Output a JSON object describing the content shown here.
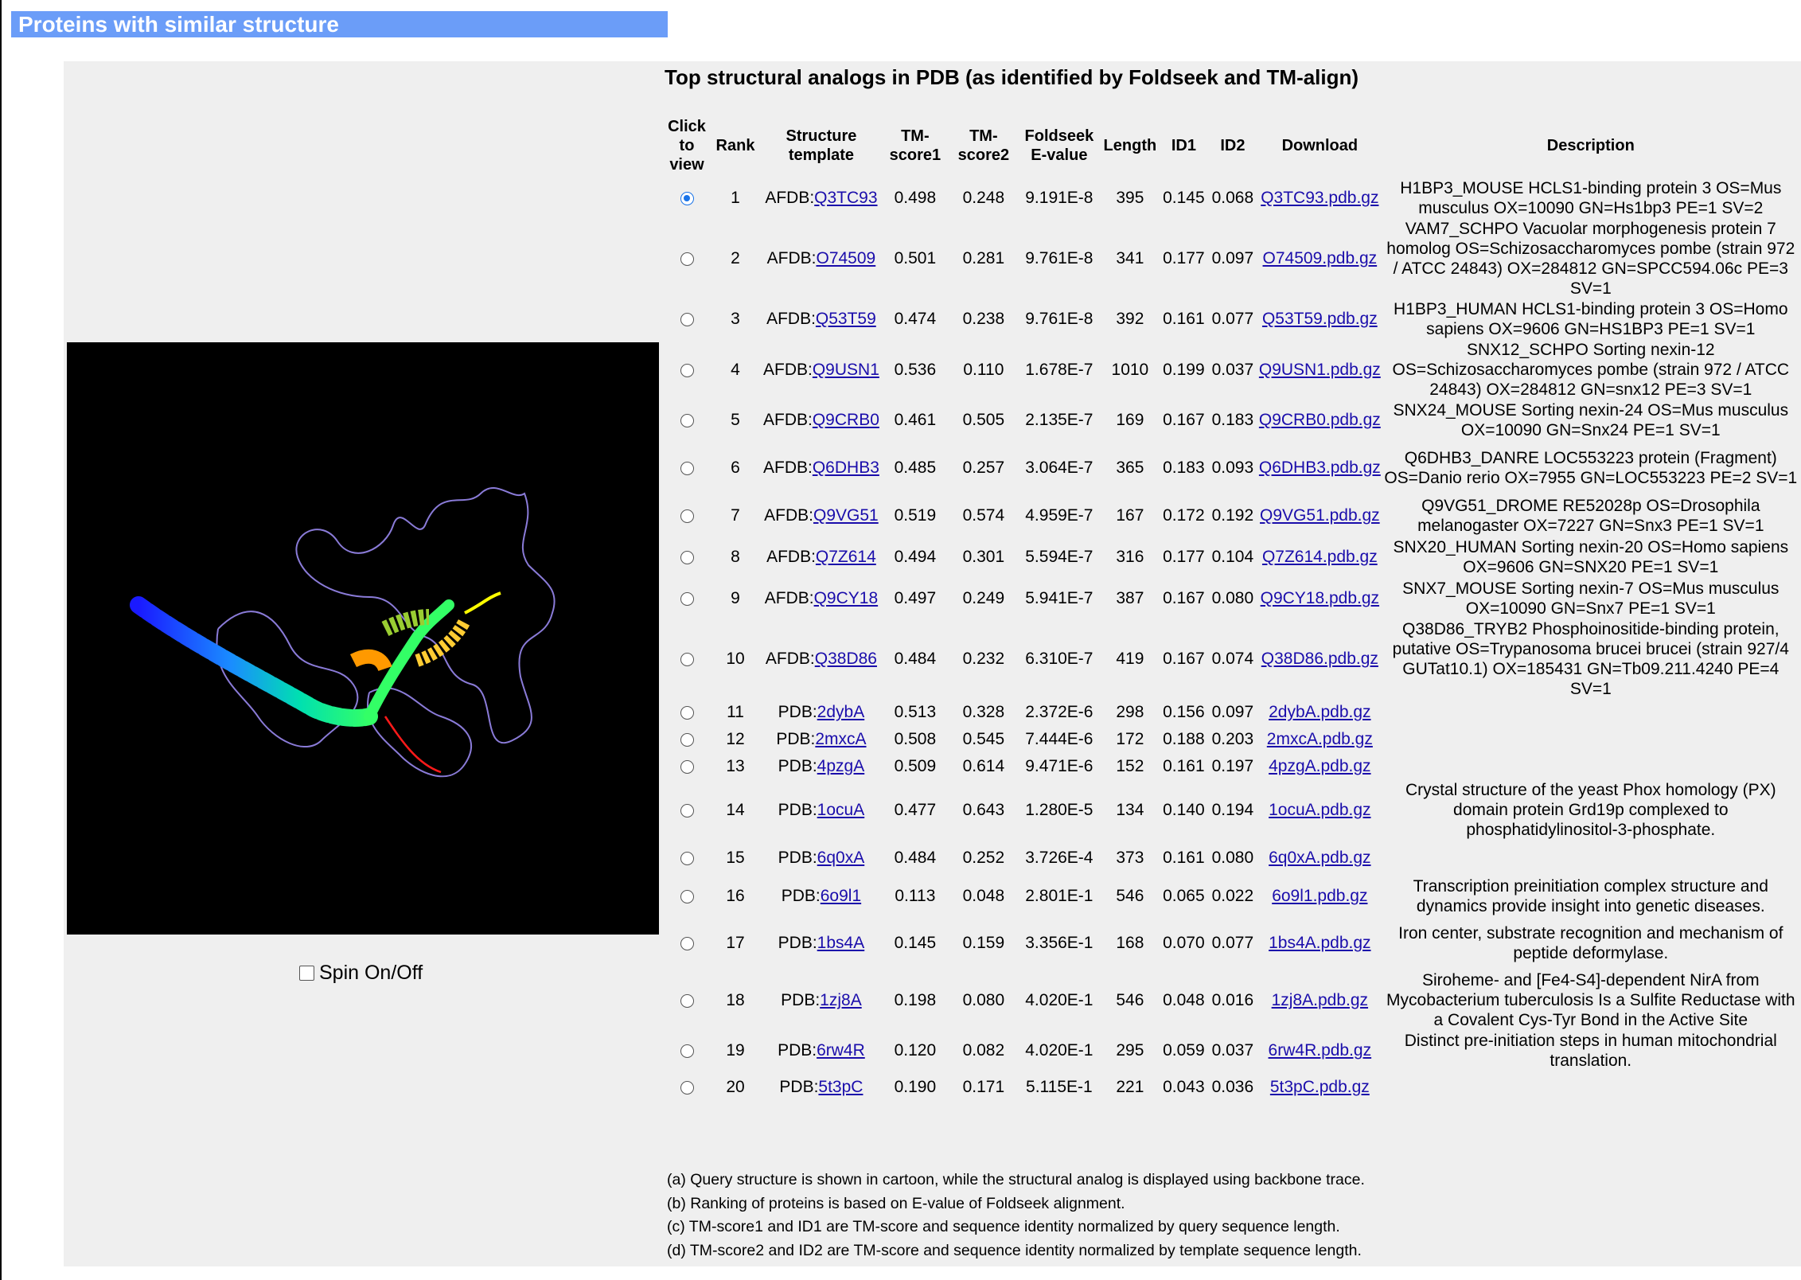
{
  "header": {
    "title": "Proteins with similar structure"
  },
  "viewer": {
    "spin_label": "Spin On/Off",
    "spin_checked": false
  },
  "table": {
    "title": "Top structural analogs in PDB (as identified by Foldseek and TM-align)",
    "columns": [
      "Click to view",
      "Rank",
      "Structure template",
      "TM-score1",
      "TM-score2",
      "Foldseek E-value",
      "Length",
      "ID1",
      "ID2",
      "Download",
      "Description"
    ],
    "rows": [
      {
        "rank": "1",
        "prefix": "AFDB:",
        "id": "Q3TC93",
        "tm1": "0.498",
        "tm2": "0.248",
        "evalue": "9.191E-8",
        "length": "395",
        "id1": "0.145",
        "id2": "0.068",
        "download": "Q3TC93.pdb.gz",
        "description": "H1BP3_MOUSE HCLS1-binding protein 3 OS=Mus musculus OX=10090 GN=Hs1bp3 PE=1 SV=2",
        "selected": true
      },
      {
        "rank": "2",
        "prefix": "AFDB:",
        "id": "O74509",
        "tm1": "0.501",
        "tm2": "0.281",
        "evalue": "9.761E-8",
        "length": "341",
        "id1": "0.177",
        "id2": "0.097",
        "download": "O74509.pdb.gz",
        "description": "VAM7_SCHPO Vacuolar morphogenesis protein 7 homolog OS=Schizosaccharomyces pombe (strain 972 / ATCC 24843) OX=284812 GN=SPCC594.06c PE=3 SV=1",
        "selected": false
      },
      {
        "rank": "3",
        "prefix": "AFDB:",
        "id": "Q53T59",
        "tm1": "0.474",
        "tm2": "0.238",
        "evalue": "9.761E-8",
        "length": "392",
        "id1": "0.161",
        "id2": "0.077",
        "download": "Q53T59.pdb.gz",
        "description": "H1BP3_HUMAN HCLS1-binding protein 3 OS=Homo sapiens OX=9606 GN=HS1BP3 PE=1 SV=1",
        "selected": false
      },
      {
        "rank": "4",
        "prefix": "AFDB:",
        "id": "Q9USN1",
        "tm1": "0.536",
        "tm2": "0.110",
        "evalue": "1.678E-7",
        "length": "1010",
        "id1": "0.199",
        "id2": "0.037",
        "download": "Q9USN1.pdb.gz",
        "description": "SNX12_SCHPO Sorting nexin-12 OS=Schizosaccharomyces pombe (strain 972 / ATCC 24843) OX=284812 GN=snx12 PE=3 SV=1",
        "selected": false
      },
      {
        "rank": "5",
        "prefix": "AFDB:",
        "id": "Q9CRB0",
        "tm1": "0.461",
        "tm2": "0.505",
        "evalue": "2.135E-7",
        "length": "169",
        "id1": "0.167",
        "id2": "0.183",
        "download": "Q9CRB0.pdb.gz",
        "description": "SNX24_MOUSE Sorting nexin-24 OS=Mus musculus OX=10090 GN=Snx24 PE=1 SV=1",
        "selected": false
      },
      {
        "rank": "6",
        "prefix": "AFDB:",
        "id": "Q6DHB3",
        "tm1": "0.485",
        "tm2": "0.257",
        "evalue": "3.064E-7",
        "length": "365",
        "id1": "0.183",
        "id2": "0.093",
        "download": "Q6DHB3.pdb.gz",
        "description": "Q6DHB3_DANRE LOC553223 protein (Fragment) OS=Danio rerio OX=7955 GN=LOC553223 PE=2 SV=1",
        "selected": false
      },
      {
        "rank": "7",
        "prefix": "AFDB:",
        "id": "Q9VG51",
        "tm1": "0.519",
        "tm2": "0.574",
        "evalue": "4.959E-7",
        "length": "167",
        "id1": "0.172",
        "id2": "0.192",
        "download": "Q9VG51.pdb.gz",
        "description": "Q9VG51_DROME RE52028p OS=Drosophila melanogaster OX=7227 GN=Snx3 PE=1 SV=1",
        "selected": false
      },
      {
        "rank": "8",
        "prefix": "AFDB:",
        "id": "Q7Z614",
        "tm1": "0.494",
        "tm2": "0.301",
        "evalue": "5.594E-7",
        "length": "316",
        "id1": "0.177",
        "id2": "0.104",
        "download": "Q7Z614.pdb.gz",
        "description": "SNX20_HUMAN Sorting nexin-20 OS=Homo sapiens OX=9606 GN=SNX20 PE=1 SV=1",
        "selected": false
      },
      {
        "rank": "9",
        "prefix": "AFDB:",
        "id": "Q9CY18",
        "tm1": "0.497",
        "tm2": "0.249",
        "evalue": "5.941E-7",
        "length": "387",
        "id1": "0.167",
        "id2": "0.080",
        "download": "Q9CY18.pdb.gz",
        "description": "SNX7_MOUSE Sorting nexin-7 OS=Mus musculus OX=10090 GN=Snx7 PE=1 SV=1",
        "selected": false
      },
      {
        "rank": "10",
        "prefix": "AFDB:",
        "id": "Q38D86",
        "tm1": "0.484",
        "tm2": "0.232",
        "evalue": "6.310E-7",
        "length": "419",
        "id1": "0.167",
        "id2": "0.074",
        "download": "Q38D86.pdb.gz",
        "description": "Q38D86_TRYB2 Phosphoinositide-binding protein, putative OS=Trypanosoma brucei brucei (strain 927/4 GUTat10.1) OX=185431 GN=Tb09.211.4240 PE=4 SV=1",
        "selected": false
      },
      {
        "rank": "11",
        "prefix": "PDB:",
        "id": "2dybA",
        "tm1": "0.513",
        "tm2": "0.328",
        "evalue": "2.372E-6",
        "length": "298",
        "id1": "0.156",
        "id2": "0.097",
        "download": "2dybA.pdb.gz",
        "description": "",
        "selected": false
      },
      {
        "rank": "12",
        "prefix": "PDB:",
        "id": "2mxcA",
        "tm1": "0.508",
        "tm2": "0.545",
        "evalue": "7.444E-6",
        "length": "172",
        "id1": "0.188",
        "id2": "0.203",
        "download": "2mxcA.pdb.gz",
        "description": "",
        "selected": false
      },
      {
        "rank": "13",
        "prefix": "PDB:",
        "id": "4pzgA",
        "tm1": "0.509",
        "tm2": "0.614",
        "evalue": "9.471E-6",
        "length": "152",
        "id1": "0.161",
        "id2": "0.197",
        "download": "4pzgA.pdb.gz",
        "description": "",
        "selected": false
      },
      {
        "rank": "14",
        "prefix": "PDB:",
        "id": "1ocuA",
        "tm1": "0.477",
        "tm2": "0.643",
        "evalue": "1.280E-5",
        "length": "134",
        "id1": "0.140",
        "id2": "0.194",
        "download": "1ocuA.pdb.gz",
        "description": "Crystal structure of the yeast Phox homology (PX) domain protein Grd19p complexed to phosphatidylinositol-3-phosphate.",
        "selected": false
      },
      {
        "rank": "15",
        "prefix": "PDB:",
        "id": "6q0xA",
        "tm1": "0.484",
        "tm2": "0.252",
        "evalue": "3.726E-4",
        "length": "373",
        "id1": "0.161",
        "id2": "0.080",
        "download": "6q0xA.pdb.gz",
        "description": "",
        "selected": false
      },
      {
        "rank": "16",
        "prefix": "PDB:",
        "id": "6o9l1",
        "tm1": "0.113",
        "tm2": "0.048",
        "evalue": "2.801E-1",
        "length": "546",
        "id1": "0.065",
        "id2": "0.022",
        "download": "6o9l1.pdb.gz",
        "description": "Transcription preinitiation complex structure and dynamics provide insight into genetic diseases.",
        "selected": false
      },
      {
        "rank": "17",
        "prefix": "PDB:",
        "id": "1bs4A",
        "tm1": "0.145",
        "tm2": "0.159",
        "evalue": "3.356E-1",
        "length": "168",
        "id1": "0.070",
        "id2": "0.077",
        "download": "1bs4A.pdb.gz",
        "description": "Iron center, substrate recognition and mechanism of peptide deformylase.",
        "selected": false
      },
      {
        "rank": "18",
        "prefix": "PDB:",
        "id": "1zj8A",
        "tm1": "0.198",
        "tm2": "0.080",
        "evalue": "4.020E-1",
        "length": "546",
        "id1": "0.048",
        "id2": "0.016",
        "download": "1zj8A.pdb.gz",
        "description": "Siroheme- and [Fe4-S4]-dependent NirA from Mycobacterium tuberculosis Is a Sulfite Reductase with a Covalent Cys-Tyr Bond in the Active Site",
        "selected": false
      },
      {
        "rank": "19",
        "prefix": "PDB:",
        "id": "6rw4R",
        "tm1": "0.120",
        "tm2": "0.082",
        "evalue": "4.020E-1",
        "length": "295",
        "id1": "0.059",
        "id2": "0.037",
        "download": "6rw4R.pdb.gz",
        "description": "Distinct pre-initiation steps in human mitochondrial translation.",
        "selected": false
      },
      {
        "rank": "20",
        "prefix": "PDB:",
        "id": "5t3pC",
        "tm1": "0.190",
        "tm2": "0.171",
        "evalue": "5.115E-1",
        "length": "221",
        "id1": "0.043",
        "id2": "0.036",
        "download": "5t3pC.pdb.gz",
        "description": "",
        "selected": false
      }
    ]
  },
  "notes": [
    "(a) Query structure is shown in cartoon, while the structural analog is displayed using backbone trace.",
    "(b) Ranking of proteins is based on E-value of Foldseek alignment.",
    "(c) TM-score1 and ID1 are TM-score and sequence identity normalized by query sequence length.",
    "(d) TM-score2 and ID2 are TM-score and sequence identity normalized by template sequence length."
  ],
  "colors": {
    "header_bg": "#6b9df8",
    "panel_bg": "#efefef",
    "link": "#1a0dab",
    "radio_selected": "#1a73e8"
  }
}
